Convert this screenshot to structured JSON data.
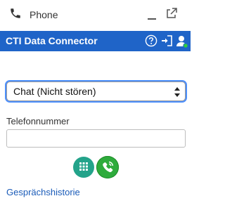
{
  "header": {
    "title": "Phone",
    "phone_icon": "phone-icon",
    "minimize_icon": "minimize-icon",
    "popout_icon": "popout-icon"
  },
  "titlebar": {
    "title": "CTI Data Connector",
    "background_color": "#1f64c8",
    "help_icon": "help-icon",
    "login_icon": "login-icon",
    "user_status_icon": "user-status-icon"
  },
  "status_select": {
    "value": "Chat (Nicht stören)"
  },
  "phone_field": {
    "label": "Telefonnummer",
    "value": ""
  },
  "buttons": {
    "dialpad_icon": "dialpad-icon",
    "call_icon": "call-icon",
    "dialpad_color": "#23a38a",
    "call_color": "#2eab3c"
  },
  "history_link": "Gesprächshistorie"
}
